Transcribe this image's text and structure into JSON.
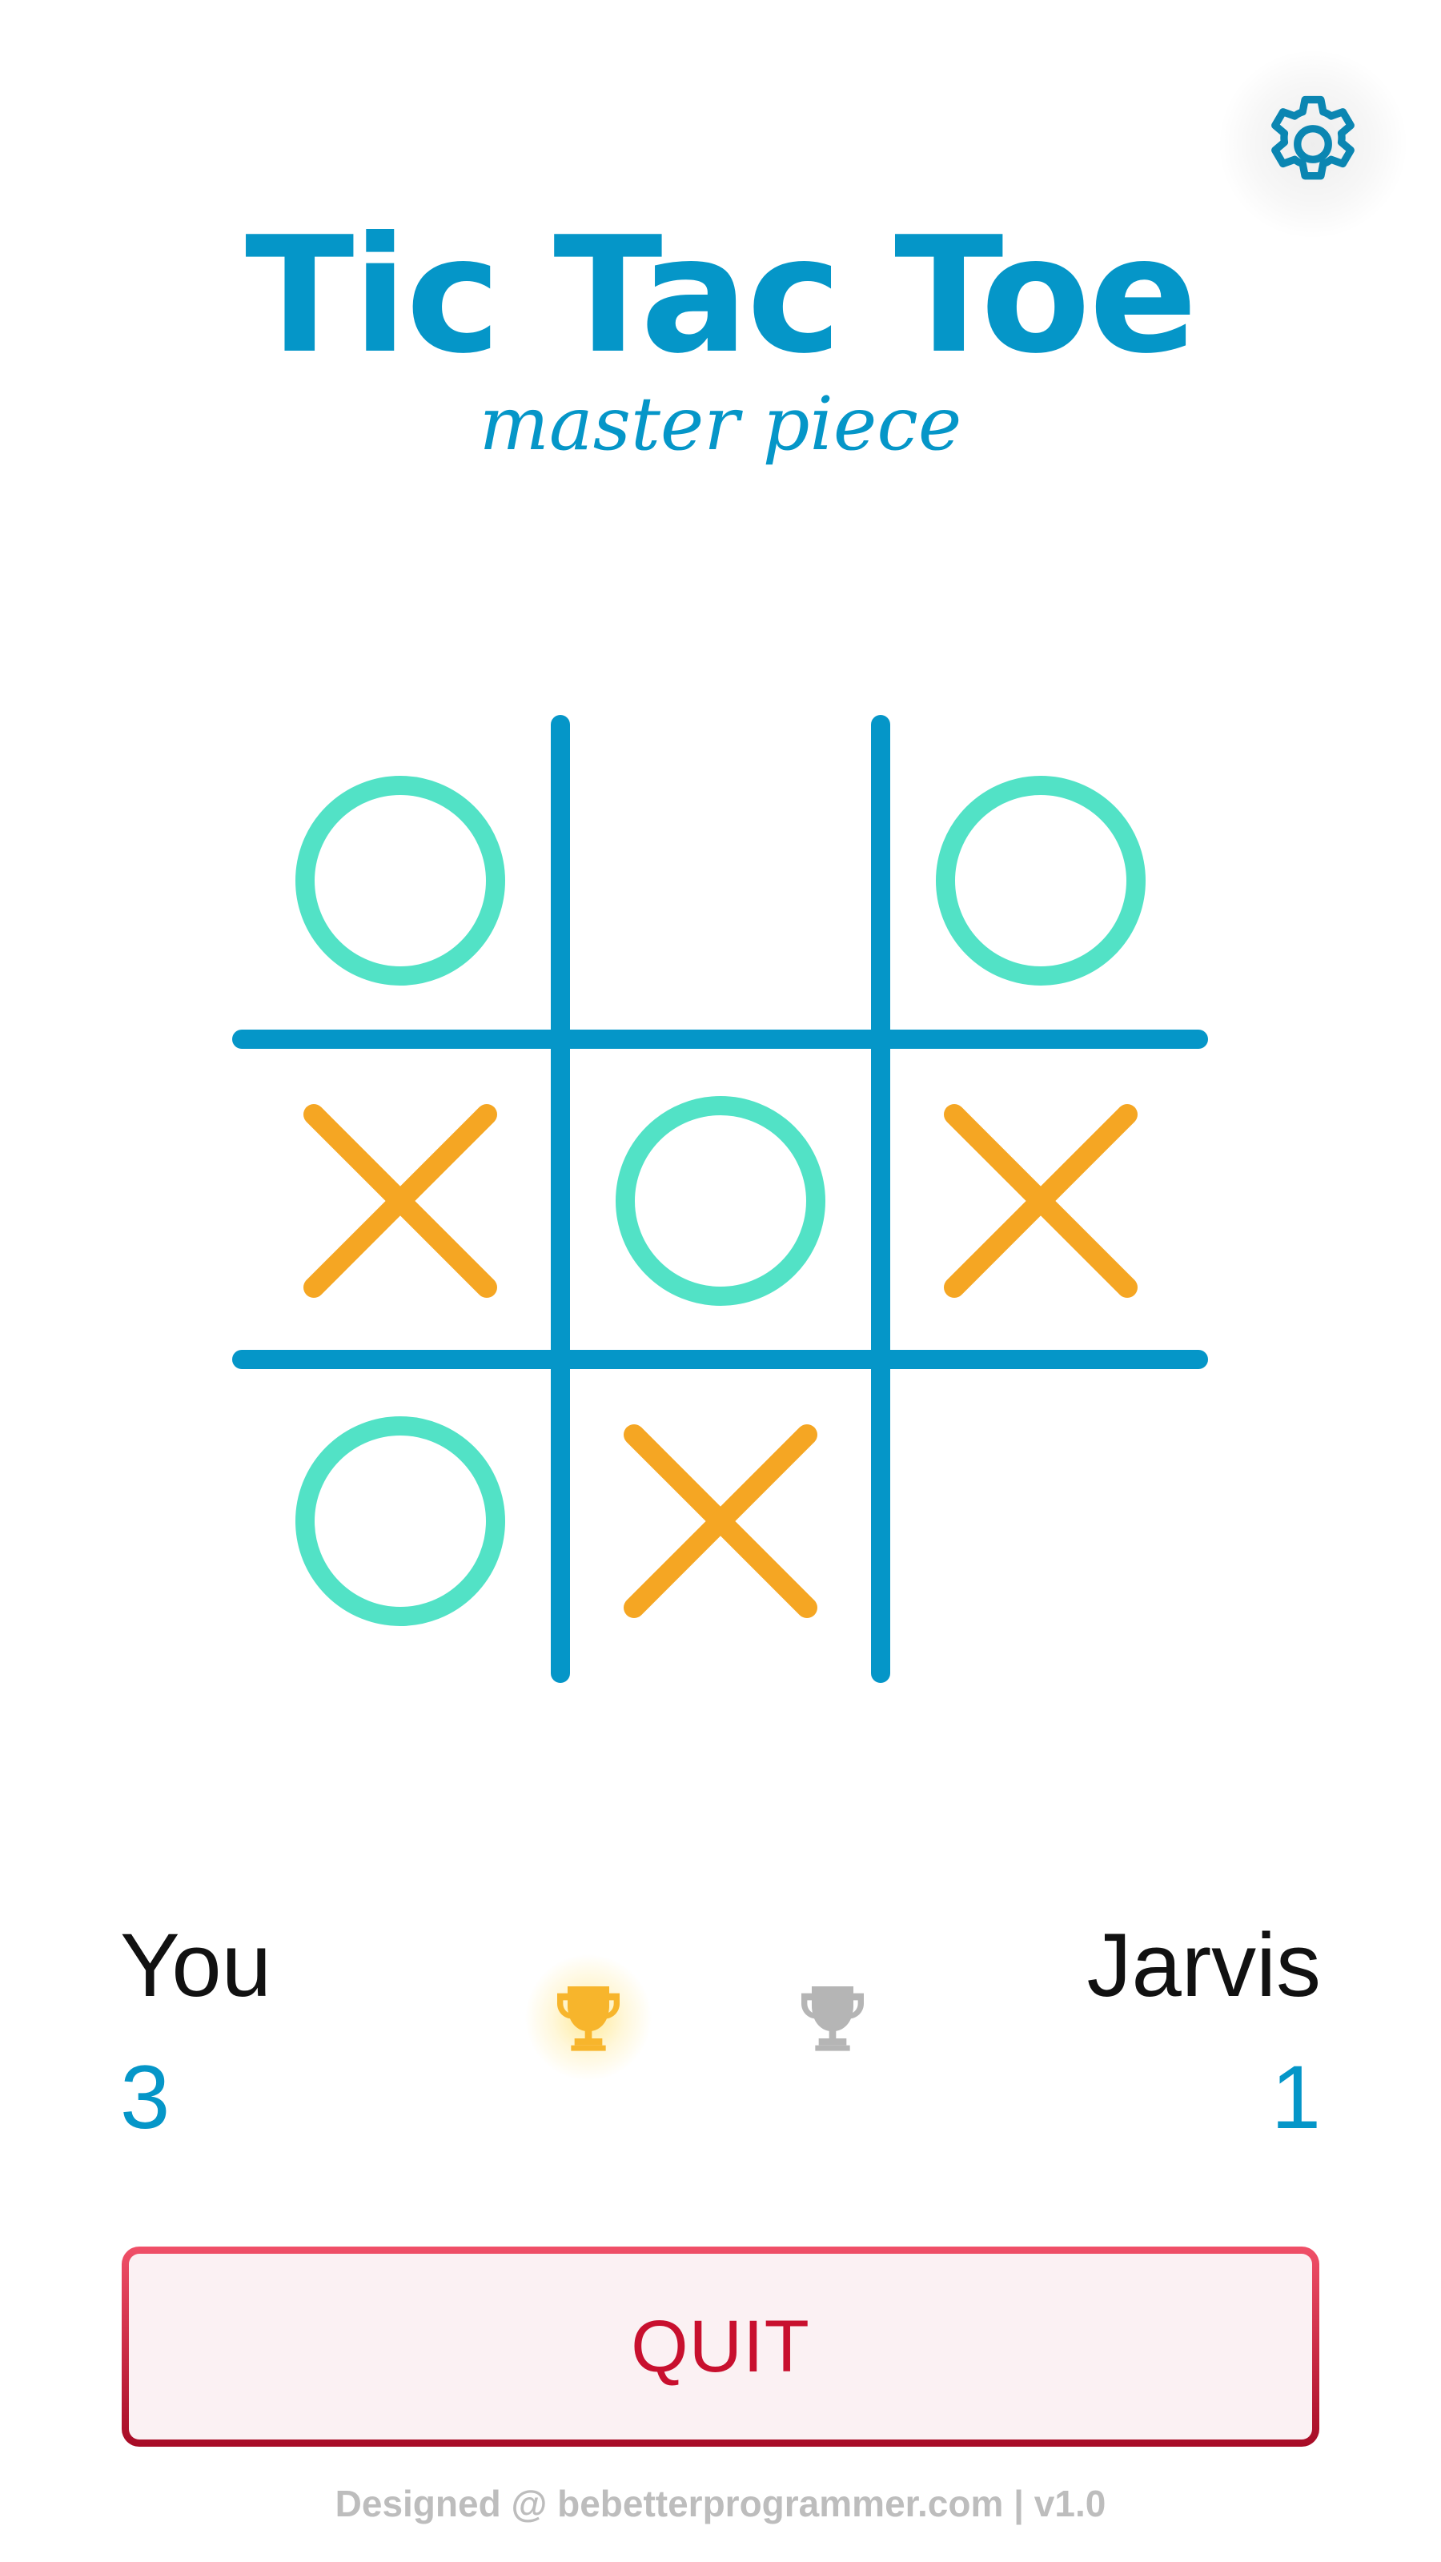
{
  "header": {
    "title": "Tic Tac Toe",
    "subtitle": "master piece",
    "settings_icon": "gear-icon"
  },
  "colors": {
    "primary": "#0596c8",
    "grid": "#0596c8",
    "o_mark": "#52e2c6",
    "x_mark": "#f5a623",
    "trophy_active": "#f7b52c",
    "trophy_inactive": "#b5b5b5",
    "quit_text": "#c8102e",
    "quit_border_top": "#f05068",
    "quit_border_bottom": "#a70c26",
    "footer_text": "#bdbdbd"
  },
  "board": {
    "cells": [
      [
        "O",
        "",
        "O"
      ],
      [
        "X",
        "O",
        "X"
      ],
      [
        "O",
        "X",
        ""
      ]
    ]
  },
  "scoreboard": {
    "player1": {
      "name": "You",
      "score": "3",
      "trophy_icon": "trophy-icon",
      "active": true
    },
    "player2": {
      "name": "Jarvis",
      "score": "1",
      "trophy_icon": "trophy-icon",
      "active": false
    }
  },
  "quit_button": {
    "label": "QUIT"
  },
  "footer": {
    "text": "Designed @ bebetterprogrammer.com | v1.0"
  }
}
